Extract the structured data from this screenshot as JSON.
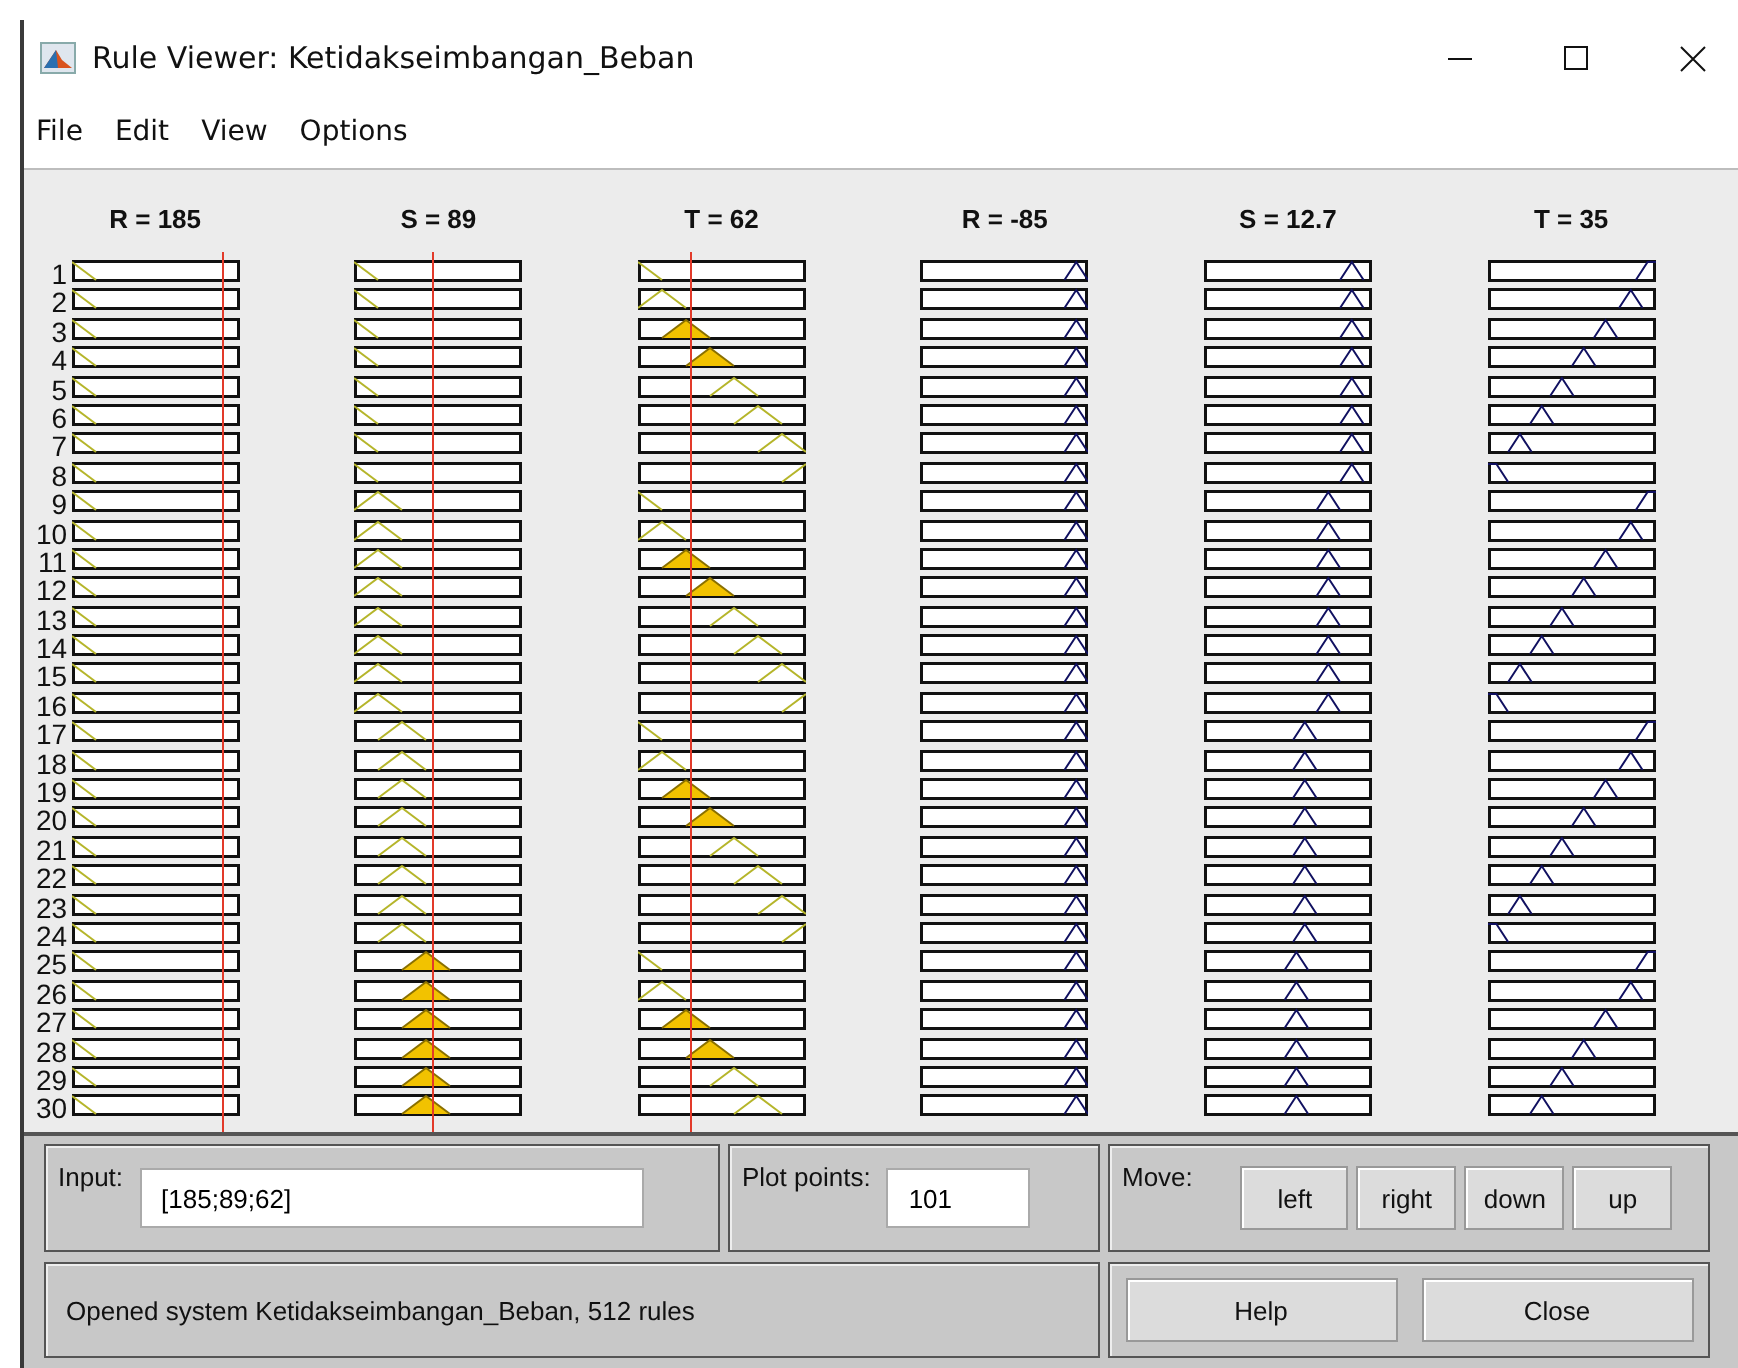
{
  "window": {
    "title": "Rule Viewer: Ketidakseimbangan_Beban"
  },
  "menu": [
    "File",
    "Edit",
    "View",
    "Options"
  ],
  "rule_numbers": [
    "1",
    "2",
    "3",
    "4",
    "5",
    "6",
    "7",
    "8",
    "9",
    "10",
    "11",
    "12",
    "13",
    "14",
    "15",
    "16",
    "17",
    "18",
    "19",
    "20",
    "21",
    "22",
    "23",
    "24",
    "25",
    "26",
    "27",
    "28",
    "29",
    "30"
  ],
  "variables": [
    {
      "label": "R = 185",
      "kind": "input"
    },
    {
      "label": "S = 89",
      "kind": "input"
    },
    {
      "label": "T = 62",
      "kind": "input"
    },
    {
      "label": "R = -85",
      "kind": "output"
    },
    {
      "label": "S = 12.7",
      "kind": "output"
    },
    {
      "label": "T = 35",
      "kind": "output"
    }
  ],
  "input": {
    "label": "Input:",
    "value": "[185;89;62]"
  },
  "plot_points": {
    "label": "Plot points:",
    "value": "101"
  },
  "move": {
    "label": "Move:",
    "buttons": [
      "left",
      "right",
      "down",
      "up"
    ]
  },
  "status": "Opened system Ketidakseimbangan_Beban, 512 rules",
  "buttons": [
    "Help",
    "Close"
  ]
}
